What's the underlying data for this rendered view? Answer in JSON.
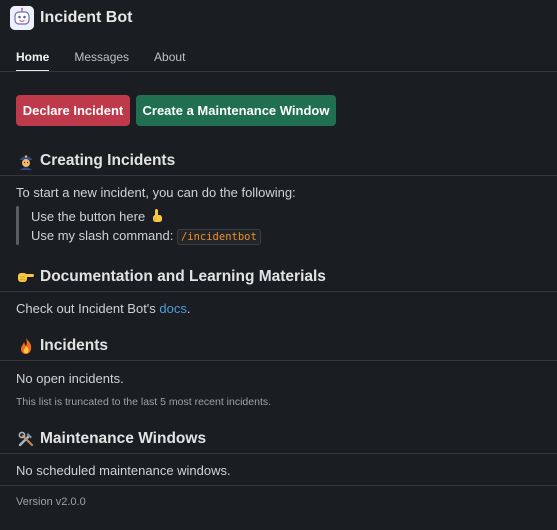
{
  "app": {
    "title": "Incident Bot"
  },
  "tabs": [
    {
      "label": "Home",
      "active": true
    },
    {
      "label": "Messages",
      "active": false
    },
    {
      "label": "About",
      "active": false
    }
  ],
  "actions": {
    "declare_label": "Declare Incident",
    "maintenance_label": "Create a Maintenance Window"
  },
  "sections": {
    "creating": {
      "icon": "police-officer-icon",
      "title": "Creating Incidents",
      "intro": "To start a new incident, you can do the following:",
      "item1": "Use the button here",
      "item1_icon": "pointing-up-icon",
      "item2": "Use my slash command:",
      "command": "/incidentbot"
    },
    "docs": {
      "icon": "pointing-right-icon",
      "title": "Documentation and Learning Materials",
      "text_prefix": "Check out Incident Bot's ",
      "link": "docs",
      "text_suffix": "."
    },
    "incidents": {
      "icon": "fire-icon",
      "title": "Incidents",
      "empty": "No open incidents.",
      "note": "This list is truncated to the last 5 most recent incidents."
    },
    "maintenance": {
      "icon": "hammer-wrench-icon",
      "title": "Maintenance Windows",
      "empty": "No scheduled maintenance windows."
    }
  },
  "footer": {
    "version": "Version v2.0.0"
  },
  "colors": {
    "background": "#1a1d21",
    "danger": "#be3a4b",
    "primary": "#1f6f50",
    "link": "#4a9fdb",
    "code": "#e8912d"
  }
}
